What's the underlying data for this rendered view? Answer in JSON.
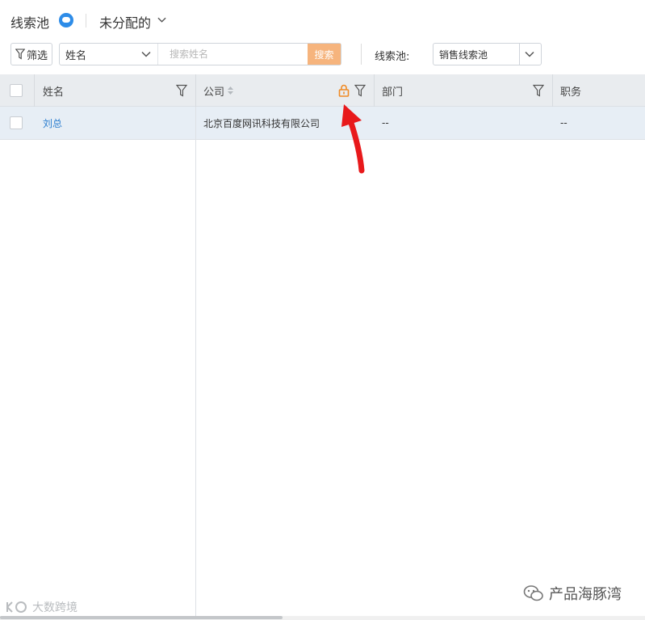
{
  "header": {
    "title": "线索池",
    "view_selector": "未分配的"
  },
  "toolbar": {
    "filter_label": "筛选",
    "search_field": "姓名",
    "search_placeholder": "搜索姓名",
    "search_button": "搜索",
    "pool_label": "线索池:",
    "pool_value": "销售线索池"
  },
  "table": {
    "columns": [
      "姓名",
      "公司",
      "部门",
      "职务"
    ],
    "rows": [
      {
        "name": "刘总",
        "company": "北京百度网讯科技有限公司",
        "department": "--",
        "position": "--"
      }
    ]
  },
  "watermarks": {
    "left": "大数跨境",
    "right": "产品海豚湾"
  },
  "colors": {
    "accent": "#2d8ce8",
    "search_button": "#f6b47d",
    "lock": "#f08a24",
    "annotation_arrow": "#e8191b",
    "row_highlight": "#e7eef5"
  }
}
